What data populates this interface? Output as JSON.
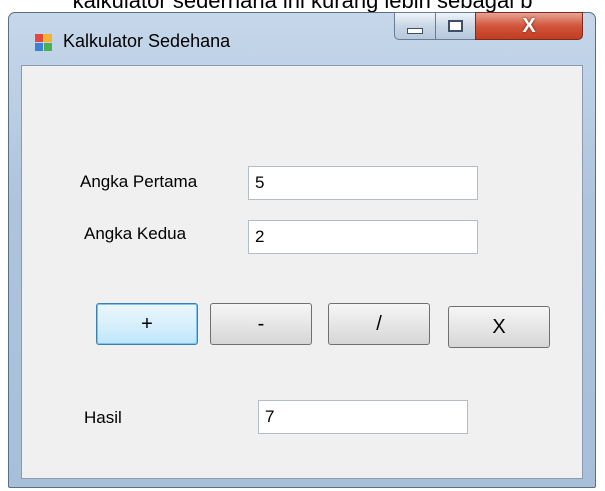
{
  "background_text": "kalkulator sederhana ini kurang lebih sebagai b",
  "window": {
    "title": "Kalkulator Sedehana",
    "controls": {
      "close_glyph": "X"
    }
  },
  "form": {
    "first_label": "Angka Pertama",
    "first_value": "5",
    "second_label": "Angka Kedua",
    "second_value": "2",
    "result_label": "Hasil",
    "result_value": "7"
  },
  "buttons": {
    "add": "+",
    "subtract": "-",
    "divide": "/",
    "multiply": "X"
  },
  "colors": {
    "client_bg": "#f0f0f0",
    "focus_border": "#3c7fb1",
    "close_red": "#c13d22"
  },
  "icons": {
    "app": "form-app-icon",
    "minimize": "minimize-icon",
    "maximize": "maximize-icon",
    "close": "close-icon"
  }
}
